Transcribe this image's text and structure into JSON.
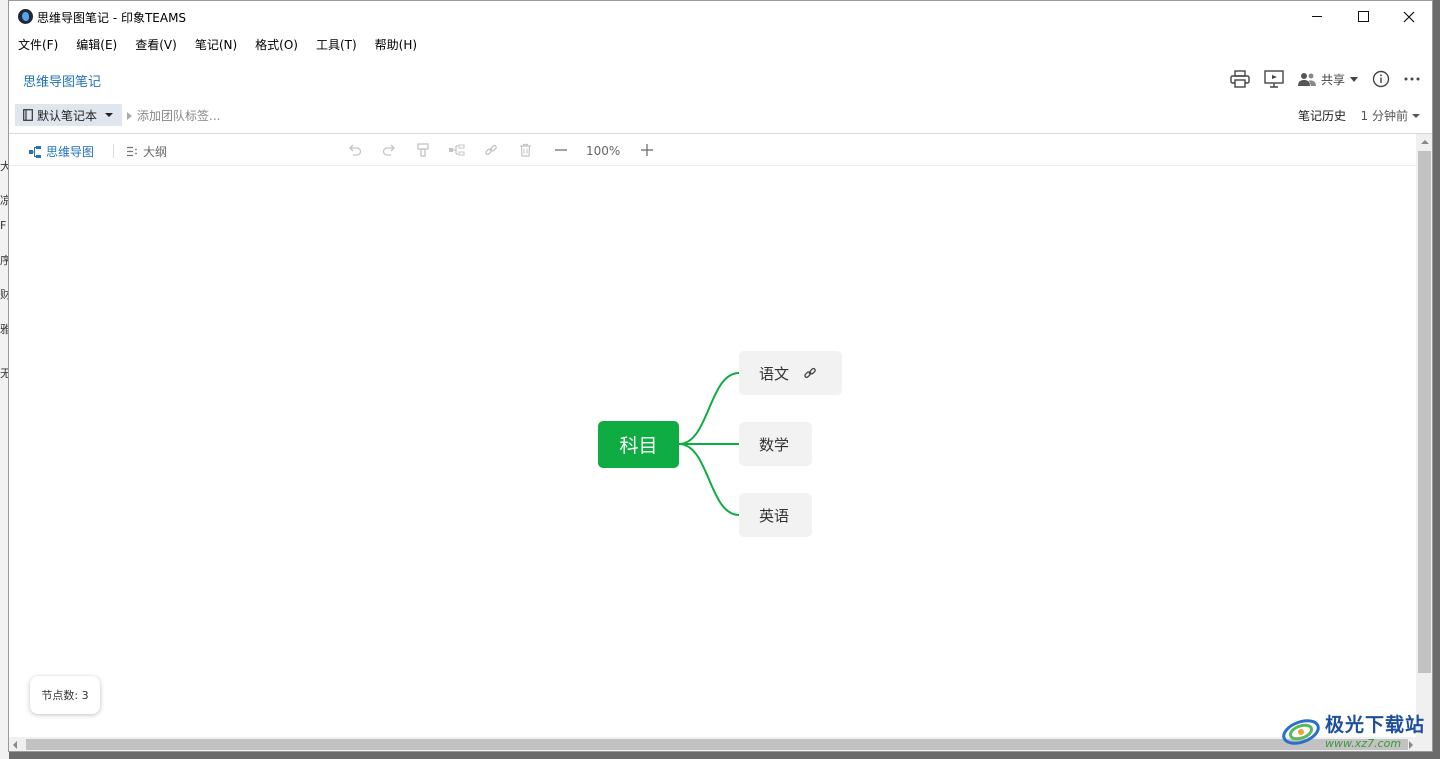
{
  "window": {
    "title": "思维导图笔记 - 印象TEAMS"
  },
  "menu": [
    {
      "label": "文件(F)"
    },
    {
      "label": "编辑(E)"
    },
    {
      "label": "查看(V)"
    },
    {
      "label": "笔记(N)"
    },
    {
      "label": "格式(O)"
    },
    {
      "label": "工具(T)"
    },
    {
      "label": "帮助(H)"
    }
  ],
  "note": {
    "title": "思维导图笔记",
    "notebook": "默认笔记本",
    "tag_placeholder": "添加团队标签...",
    "history_label": "笔记历史",
    "history_time": "1 分钟前"
  },
  "toolbar": {
    "share_label": "共享"
  },
  "editor": {
    "mode_mindmap": "思维导图",
    "mode_outline": "大纲",
    "zoom": "100%",
    "node_count": "节点数: 3"
  },
  "mindmap": {
    "root": "科目",
    "children": [
      "语文",
      "数学",
      "英语"
    ],
    "accent": "#0fac43"
  },
  "watermark": {
    "name": "极光下载站",
    "url": "www.xz7.com"
  },
  "background_fragments": [
    "大",
    "凉",
    "F",
    "序",
    "财",
    "雅",
    "无"
  ]
}
